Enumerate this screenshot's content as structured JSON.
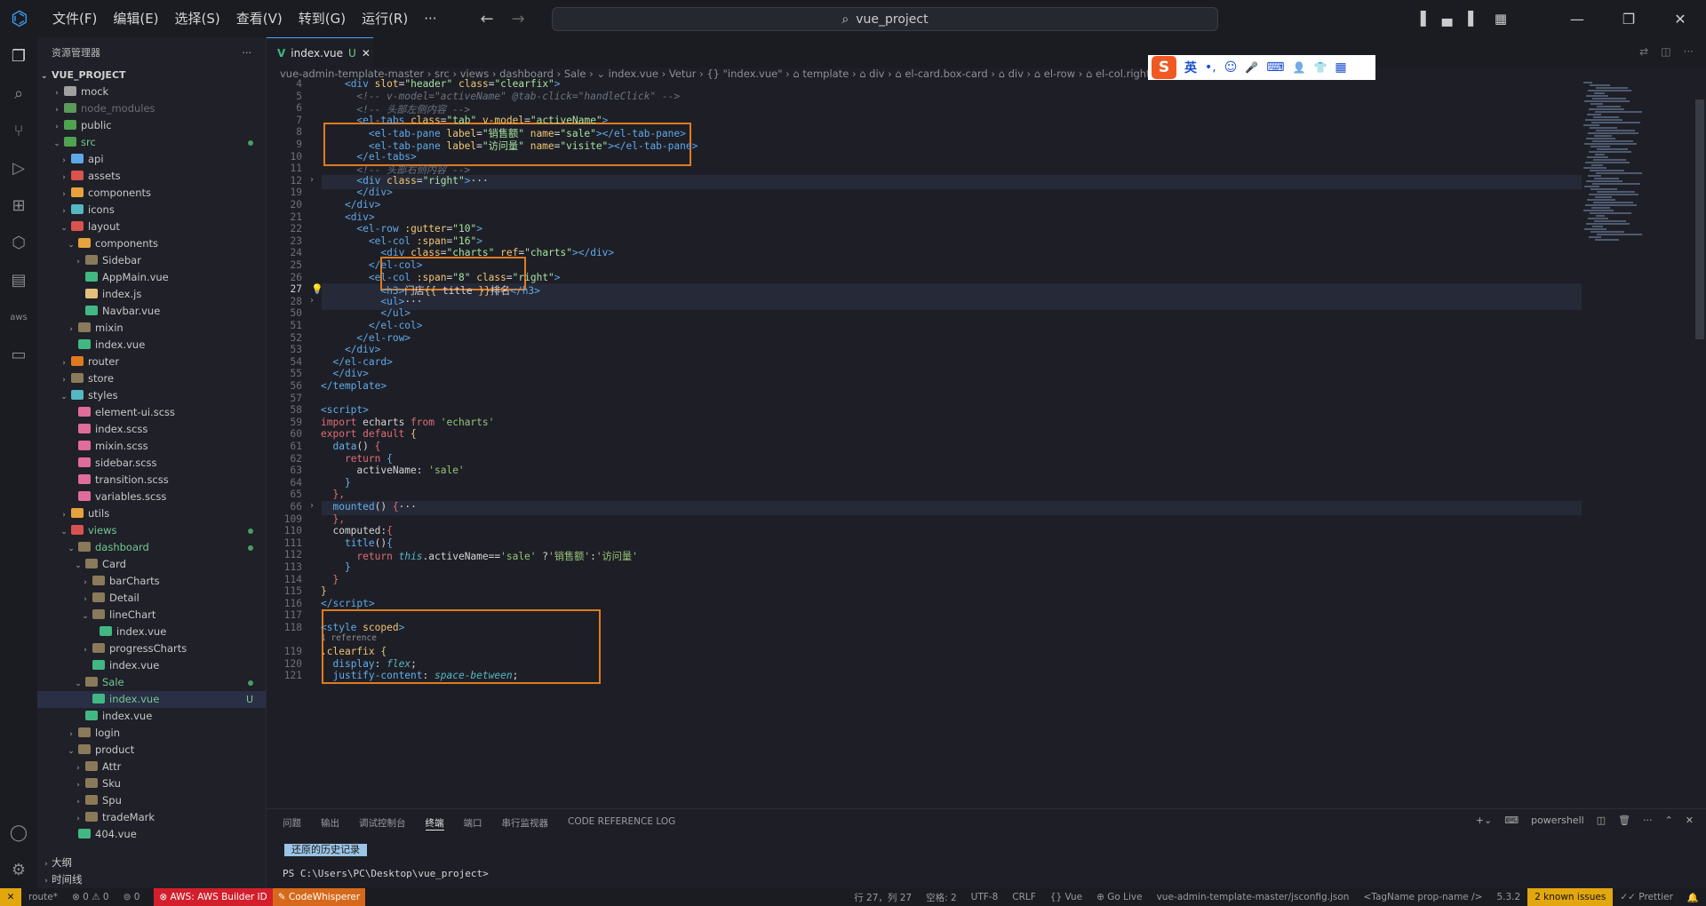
{
  "titlebar": {
    "menu": [
      "文件(F)",
      "编辑(E)",
      "选择(S)",
      "查看(V)",
      "转到(G)",
      "运行(R)",
      "···"
    ],
    "search": "vue_project"
  },
  "sidebar": {
    "header": "资源管理器",
    "more": "···",
    "root": "VUE_PROJECT",
    "items": [
      {
        "label": "mock",
        "indent": 1,
        "chev": "›",
        "color": "#a0a0a0"
      },
      {
        "label": "node_modules",
        "indent": 1,
        "chev": "›",
        "color": "#5a9a5a",
        "dim": true
      },
      {
        "label": "public",
        "indent": 1,
        "chev": "›",
        "color": "#4fa34f"
      },
      {
        "label": "src",
        "indent": 1,
        "chev": "⌄",
        "color": "#4fa34f",
        "dot": true,
        "green": true
      },
      {
        "label": "api",
        "indent": 2,
        "chev": "›",
        "color": "#5fa8e8"
      },
      {
        "label": "assets",
        "indent": 2,
        "chev": "›",
        "color": "#d9534f"
      },
      {
        "label": "components",
        "indent": 2,
        "chev": "›",
        "color": "#e6a23c"
      },
      {
        "label": "icons",
        "indent": 2,
        "chev": "›",
        "color": "#56b6c2"
      },
      {
        "label": "layout",
        "indent": 2,
        "chev": "⌄",
        "color": "#d9534f"
      },
      {
        "label": "components",
        "indent": 3,
        "chev": "⌄",
        "color": "#e6a23c"
      },
      {
        "label": "Sidebar",
        "indent": 4,
        "chev": "›",
        "color": "#8a7a5a"
      },
      {
        "label": "AppMain.vue",
        "indent": 4,
        "chev": "",
        "color": "#41b883"
      },
      {
        "label": "index.js",
        "indent": 4,
        "chev": "",
        "color": "#e5c07b"
      },
      {
        "label": "Navbar.vue",
        "indent": 4,
        "chev": "",
        "color": "#41b883"
      },
      {
        "label": "mixin",
        "indent": 3,
        "chev": "›",
        "color": "#8a7a5a"
      },
      {
        "label": "index.vue",
        "indent": 3,
        "chev": "",
        "color": "#41b883"
      },
      {
        "label": "router",
        "indent": 2,
        "chev": "›",
        "color": "#e07a1f"
      },
      {
        "label": "store",
        "indent": 2,
        "chev": "›",
        "color": "#8a7a5a"
      },
      {
        "label": "styles",
        "indent": 2,
        "chev": "⌄",
        "color": "#56b6c2"
      },
      {
        "label": "element-ui.scss",
        "indent": 3,
        "chev": "",
        "color": "#e06c9a"
      },
      {
        "label": "index.scss",
        "indent": 3,
        "chev": "",
        "color": "#e06c9a"
      },
      {
        "label": "mixin.scss",
        "indent": 3,
        "chev": "",
        "color": "#e06c9a"
      },
      {
        "label": "sidebar.scss",
        "indent": 3,
        "chev": "",
        "color": "#e06c9a"
      },
      {
        "label": "transition.scss",
        "indent": 3,
        "chev": "",
        "color": "#e06c9a"
      },
      {
        "label": "variables.scss",
        "indent": 3,
        "chev": "",
        "color": "#e06c9a"
      },
      {
        "label": "utils",
        "indent": 2,
        "chev": "›",
        "color": "#e6a23c"
      },
      {
        "label": "views",
        "indent": 2,
        "chev": "⌄",
        "color": "#d9534f",
        "dot": true,
        "green": true
      },
      {
        "label": "dashboard",
        "indent": 3,
        "chev": "⌄",
        "color": "#8a7a5a",
        "dot": true,
        "green": true
      },
      {
        "label": "Card",
        "indent": 4,
        "chev": "⌄",
        "color": "#8a7a5a"
      },
      {
        "label": "barCharts",
        "indent": 5,
        "chev": "›",
        "color": "#8a7a5a"
      },
      {
        "label": "Detail",
        "indent": 5,
        "chev": "›",
        "color": "#8a7a5a"
      },
      {
        "label": "lineChart",
        "indent": 5,
        "chev": "⌄",
        "color": "#8a7a5a"
      },
      {
        "label": "index.vue",
        "indent": 6,
        "chev": "",
        "color": "#41b883"
      },
      {
        "label": "progressCharts",
        "indent": 5,
        "chev": "›",
        "color": "#8a7a5a"
      },
      {
        "label": "index.vue",
        "indent": 5,
        "chev": "",
        "color": "#41b883"
      },
      {
        "label": "Sale",
        "indent": 4,
        "chev": "⌄",
        "color": "#8a7a5a",
        "dot": true,
        "green": true
      },
      {
        "label": "index.vue",
        "indent": 5,
        "chev": "",
        "color": "#41b883",
        "badge": "U",
        "selected": true,
        "green": true
      },
      {
        "label": "index.vue",
        "indent": 4,
        "chev": "",
        "color": "#41b883"
      },
      {
        "label": "login",
        "indent": 3,
        "chev": "›",
        "color": "#8a7a5a"
      },
      {
        "label": "product",
        "indent": 3,
        "chev": "⌄",
        "color": "#8a7a5a"
      },
      {
        "label": "Attr",
        "indent": 4,
        "chev": "›",
        "color": "#8a7a5a"
      },
      {
        "label": "Sku",
        "indent": 4,
        "chev": "›",
        "color": "#8a7a5a"
      },
      {
        "label": "Spu",
        "indent": 4,
        "chev": "›",
        "color": "#8a7a5a"
      },
      {
        "label": "tradeMark",
        "indent": 4,
        "chev": "›",
        "color": "#8a7a5a"
      },
      {
        "label": "404.vue",
        "indent": 3,
        "chev": "",
        "color": "#41b883"
      }
    ],
    "outline": "大纲",
    "timeline": "时间线"
  },
  "editor": {
    "tab_label": "index.vue",
    "tab_badge": "U",
    "breadcrumb": "vue-admin-template-master › src › views › dashboard › Sale › ⌄ index.vue › Vetur › {} \"index.vue\" › ⌂ template › ⌂ div › ⌂ el-card.box-card › ⌂ div › ⌂ el-row › ⌂ el-col.right › ⌂ h"
  },
  "ime": {
    "brand": "S",
    "lang": "英",
    "punct": "•,",
    "smile": "☺",
    "mic": "🎤",
    "kbd": "⌨",
    "person": "👤",
    "shirt": "👕",
    "grid": "▦"
  },
  "code": {
    "lines": [
      {
        "n": "4",
        "html": "    <span class='tg'>&lt;div</span> <span class='ta'>slot</span>=<span class='tv'>\"header\"</span> <span class='ta'>class</span>=<span class='tv'>\"clearfix\"</span><span class='tg'>&gt;</span>"
      },
      {
        "n": "5",
        "html": "      <span class='tc'>&lt;!-- v-model=\"activeName\" @tab-click=\"handleClick\" --&gt;</span>"
      },
      {
        "n": "6",
        "html": "      <span class='tc'>&lt;!-- 头部左侧内容 --&gt;</span>"
      },
      {
        "n": "7",
        "html": "      <span class='tg'>&lt;el-tabs</span> <span class='ta'>class</span>=<span class='tv'>\"tab\"</span> <span class='ta'>v-model</span>=<span class='tv'>\"activeName\"</span><span class='tg'>&gt;</span>"
      },
      {
        "n": "8",
        "html": "        <span class='tg'>&lt;el-tab-pane</span> <span class='ta'>label</span>=<span class='tv'>\"销售额\"</span> <span class='ta'>name</span>=<span class='tv'>\"sale\"</span><span class='tg'>&gt;&lt;/el-tab-pane&gt;</span>"
      },
      {
        "n": "9",
        "html": "        <span class='tg'>&lt;el-tab-pane</span> <span class='ta'>label</span>=<span class='tv'>\"访问量\"</span> <span class='ta'>name</span>=<span class='tv'>\"visite\"</span><span class='tg'>&gt;&lt;/el-tab-pane&gt;</span>"
      },
      {
        "n": "10",
        "html": "      <span class='tg'>&lt;/el-tabs&gt;</span>"
      },
      {
        "n": "11",
        "html": "      <span class='tc'>&lt;!-- 头部右侧内容 --&gt;</span>"
      },
      {
        "n": "12",
        "html": "      <span class='tg'>&lt;div</span> <span class='ta'>class</span>=<span class='tv'>\"right\"</span><span class='tg'>&gt;</span>···",
        "fold": true,
        "band": true
      },
      {
        "n": "19",
        "html": "      <span class='tg'>&lt;/div&gt;</span>"
      },
      {
        "n": "20",
        "html": "    <span class='tg'>&lt;/div&gt;</span>"
      },
      {
        "n": "21",
        "html": "    <span class='tg'>&lt;div&gt;</span>"
      },
      {
        "n": "22",
        "html": "      <span class='tg'>&lt;el-row</span> <span class='ta'>:gutter</span>=<span class='tv'>\"10\"</span><span class='tg'>&gt;</span>"
      },
      {
        "n": "23",
        "html": "        <span class='tg'>&lt;el-col</span> <span class='ta'>:span</span>=<span class='tv'>\"16\"</span><span class='tg'>&gt;</span>"
      },
      {
        "n": "24",
        "html": "          <span class='tg'>&lt;div</span> <span class='ta'>class</span>=<span class='tv'>\"charts\"</span> <span class='ta'>ref</span>=<span class='tv'>\"charts\"</span><span class='tg'>&gt;&lt;/div&gt;</span>"
      },
      {
        "n": "25",
        "html": "        <span class='tg'>&lt;/el-col&gt;</span>"
      },
      {
        "n": "26",
        "html": "        <span class='tg'>&lt;el-col</span> <span class='ta'>:span</span>=<span class='tv'>\"8\"</span> <span class='ta'>class</span>=<span class='tv'>\"right\"</span><span class='tg'>&gt;</span>"
      },
      {
        "n": "27",
        "html": "          <span class='tg'>&lt;h3&gt;</span>门店<span class='tp'>{{</span> title <span class='tp'>}}</span>排名<span class='tg'>&lt;/h3&gt;</span>",
        "current": true,
        "bulb": true
      },
      {
        "n": "28",
        "html": "          <span class='tg'>&lt;ul&gt;</span>···",
        "fold": true,
        "band": true
      },
      {
        "n": "50",
        "html": "          <span class='tg'>&lt;/ul&gt;</span>"
      },
      {
        "n": "51",
        "html": "        <span class='tg'>&lt;/el-col&gt;</span>"
      },
      {
        "n": "52",
        "html": "      <span class='tg'>&lt;/el-row&gt;</span>"
      },
      {
        "n": "53",
        "html": "    <span class='tg'>&lt;/div&gt;</span>"
      },
      {
        "n": "54",
        "html": "  <span class='tg'>&lt;/el-card&gt;</span>"
      },
      {
        "n": "55",
        "html": "  <span class='tg'>&lt;/div&gt;</span>"
      },
      {
        "n": "56",
        "html": "<span class='tg'>&lt;/template&gt;</span>"
      },
      {
        "n": "57",
        "html": ""
      },
      {
        "n": "58",
        "html": "<span class='tg'>&lt;script&gt;</span>"
      },
      {
        "n": "59",
        "html": "<span class='tk'>import</span> echarts <span class='tk'>from</span> <span class='ts'>'echarts'</span>"
      },
      {
        "n": "60",
        "html": "<span class='tk'>export default</span> <span class='tp'>{</span>"
      },
      {
        "n": "61",
        "html": "  <span class='tf'>data</span>() <span class='tk'>{</span>"
      },
      {
        "n": "62",
        "html": "    <span class='tk'>return</span> <span class='tf'>{</span>"
      },
      {
        "n": "63",
        "html": "      activeName: <span class='ts'>'sale'</span>"
      },
      {
        "n": "64",
        "html": "    <span class='tf'>}</span>"
      },
      {
        "n": "65",
        "html": "  <span class='tk'>},</span>"
      },
      {
        "n": "66",
        "html": "  <span class='tf'>mounted</span>() <span class='tk'>{</span>···",
        "fold": true,
        "band": true
      },
      {
        "n": "109",
        "html": "  <span class='tk'>},</span>"
      },
      {
        "n": "110",
        "html": "  computed:<span class='tk'>{</span>"
      },
      {
        "n": "111",
        "html": "    <span class='tf'>title</span>()<span class='tf'>{</span>"
      },
      {
        "n": "112",
        "html": "      <span class='tk'>return</span> <span class='ti'>this</span>.activeName==<span class='ts'>'sale'</span> ?<span class='ts'>'销售额'</span>:<span class='ts'>'访问量'</span>"
      },
      {
        "n": "113",
        "html": "    <span class='tf'>}</span>"
      },
      {
        "n": "114",
        "html": "  <span class='tk'>}</span>"
      },
      {
        "n": "115",
        "html": "<span class='tp'>}</span>"
      },
      {
        "n": "116",
        "html": "<span class='tg'>&lt;/script&gt;</span>"
      },
      {
        "n": "117",
        "html": ""
      },
      {
        "n": "118",
        "html": "<span class='tg'>&lt;style</span> <span class='ta'>scoped</span><span class='tg'>&gt;</span>",
        "ref": "1 reference"
      },
      {
        "n": "119",
        "html": "<span class='ta'>.clearfix</span> <span class='tp'>{</span>"
      },
      {
        "n": "120",
        "html": "  <span class='tf'>display</span>: <span class='ti'>flex</span>;"
      },
      {
        "n": "121",
        "html": "  <span class='tf'>justify-content</span>: <span class='ti'>space-between</span>;"
      }
    ]
  },
  "panel": {
    "tabs": [
      "问题",
      "输出",
      "调试控制台",
      "终端",
      "端口",
      "串行监视器",
      "CODE REFERENCE LOG"
    ],
    "active_tab": "终端",
    "shell": "powershell",
    "restored": "还原的历史记录",
    "prompt": "PS C:\\Users\\PC\\Desktop\\vue_project>"
  },
  "status": {
    "remote": "✕",
    "branch": "route*",
    "errors": "⊗ 0 ⚠ 0",
    "ports": "⊚ 0",
    "aws": "⊗ AWS: AWS Builder ID",
    "codewhisperer": "✎ CodeWhisperer",
    "right": [
      "行 27，列 27",
      "空格: 2",
      "UTF-8",
      "CRLF",
      "{} Vue",
      "⊕ Go Live",
      "vue-admin-template-master/jsconfig.json",
      "<TagName prop-name />",
      "5.3.2"
    ],
    "issues": "2 known issues",
    "prettier": "✓✓ Prettier"
  }
}
